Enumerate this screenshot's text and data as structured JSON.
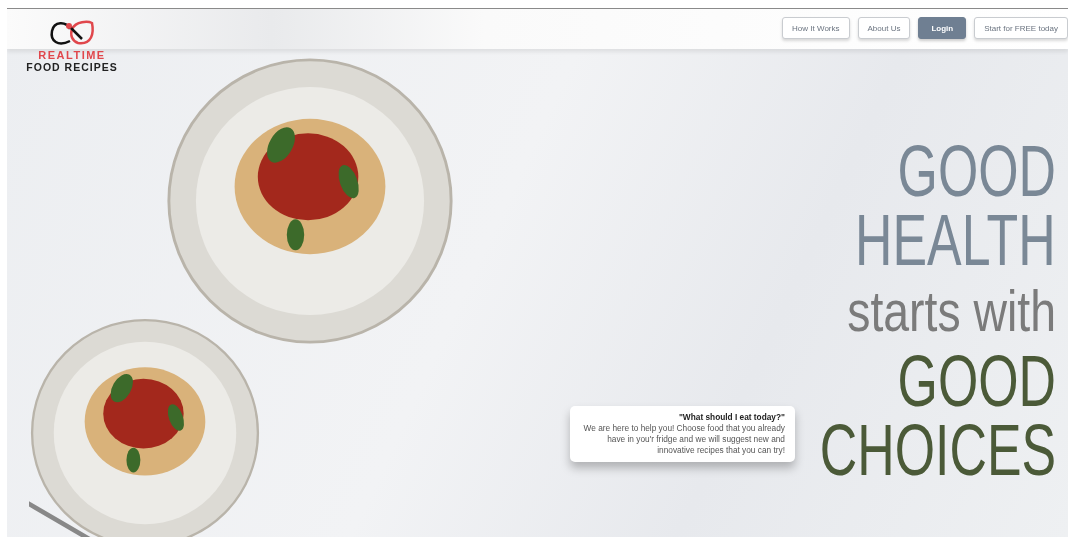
{
  "logo": {
    "line_1": "REALTIME",
    "line_2": "FOOD RECIPES"
  },
  "nav": [
    {
      "label": "How It Works",
      "kind": "outline"
    },
    {
      "label": "About Us",
      "kind": "outline"
    },
    {
      "label": "Login",
      "kind": "primary"
    },
    {
      "label": "Start for FREE today",
      "kind": "outline"
    }
  ],
  "headline": [
    {
      "text": "GOOD",
      "color": "#7a8896"
    },
    {
      "text": "HEALTH",
      "color": "#7a8896"
    },
    {
      "text": "starts with",
      "color": "#7b7b7b"
    },
    {
      "text": "GOOD",
      "color": "#4b5a38"
    },
    {
      "text": "CHOICES",
      "color": "#4b5a38"
    }
  ],
  "callout": {
    "title": "\"What should I eat today?\"",
    "body": "We are here to help you! Choose food that you already have in you'r fridge and we will suggest new and innovative recipes that you can try!"
  }
}
